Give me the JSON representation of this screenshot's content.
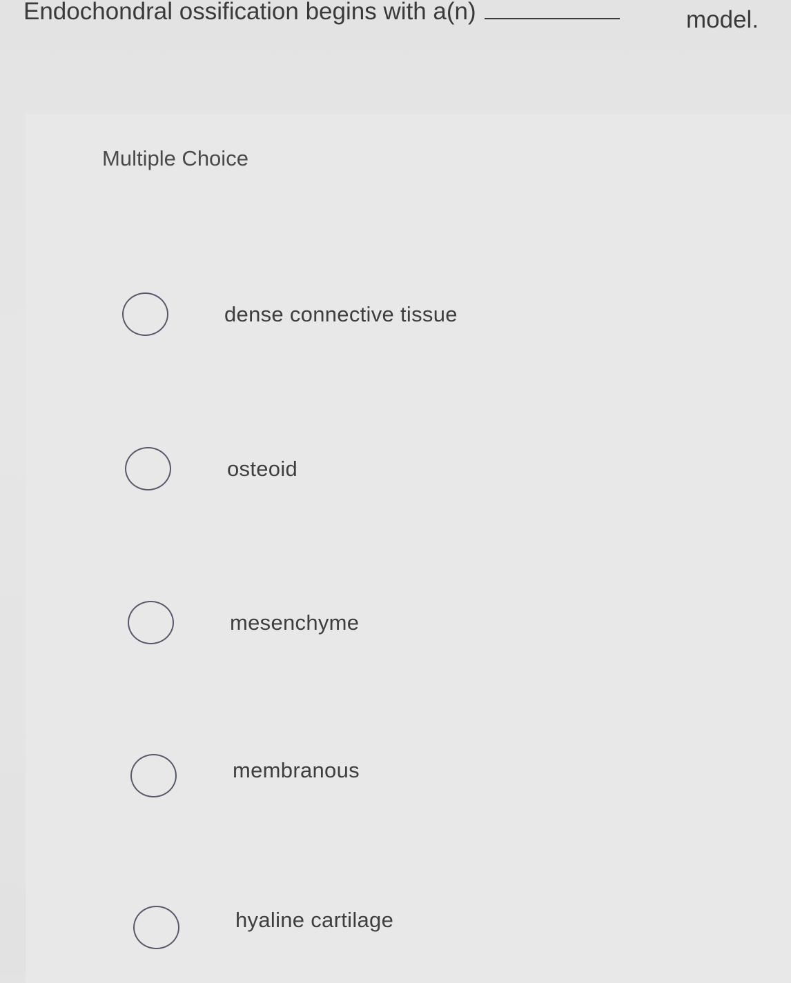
{
  "question": {
    "prefix": "Endochondral ossification begins with a(n)",
    "suffix": "model."
  },
  "section_label": "Multiple Choice",
  "options": [
    {
      "label": "dense connective tissue",
      "selected": false
    },
    {
      "label": "osteoid",
      "selected": false
    },
    {
      "label": "mesenchyme",
      "selected": false
    },
    {
      "label": "membranous",
      "selected": false
    },
    {
      "label": "hyaline cartilage",
      "selected": false
    }
  ],
  "colors": {
    "background": "#e4e4e4",
    "card": "#e8e8e8",
    "text": "#3b3b3b",
    "radio_border": "#55596a"
  }
}
